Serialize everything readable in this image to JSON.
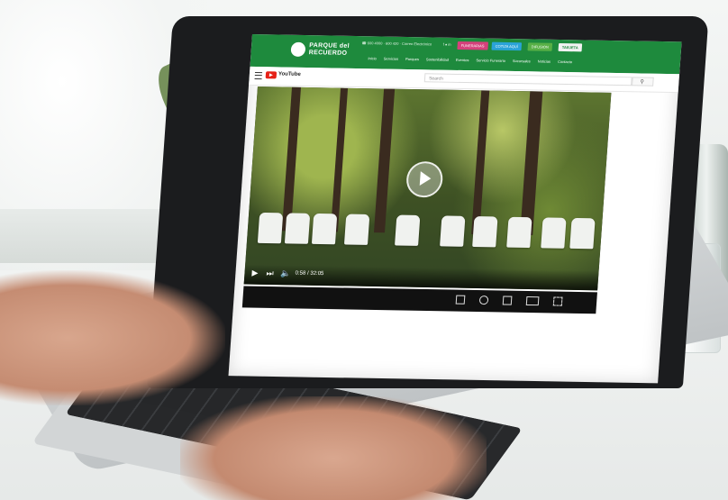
{
  "site": {
    "logo_line1": "PARQUE del",
    "logo_line2": "RECUERDO",
    "contact": "☎ 600 4000 · 600 420 · Correo Electrónico",
    "social": "f ● in",
    "cta_buttons": [
      "FUNERARIAS",
      "COTIZA AQUÍ",
      "DIFUSIÓN",
      "TARJETA"
    ],
    "nav": [
      "Inicio",
      "Servicios",
      "Parques",
      "Sostenibilidad",
      "Eventos",
      "Servicio Funerario",
      "Sucursales",
      "Noticias",
      "Contacto"
    ]
  },
  "youtube": {
    "logo_text": "YouTube",
    "search_placeholder": "Search"
  },
  "player": {
    "time": "0:58 / 32:05"
  },
  "icons": {
    "play": "play-icon",
    "next": "next-icon",
    "volume": "volume-icon",
    "captions": "captions-icon",
    "settings": "settings-icon",
    "miniplayer": "miniplayer-icon",
    "theater": "theater-icon",
    "fullscreen": "fullscreen-icon",
    "search": "search-icon",
    "menu": "menu-icon"
  },
  "colors": {
    "brand_green": "#1e8a3d",
    "youtube_red": "#e62117"
  }
}
